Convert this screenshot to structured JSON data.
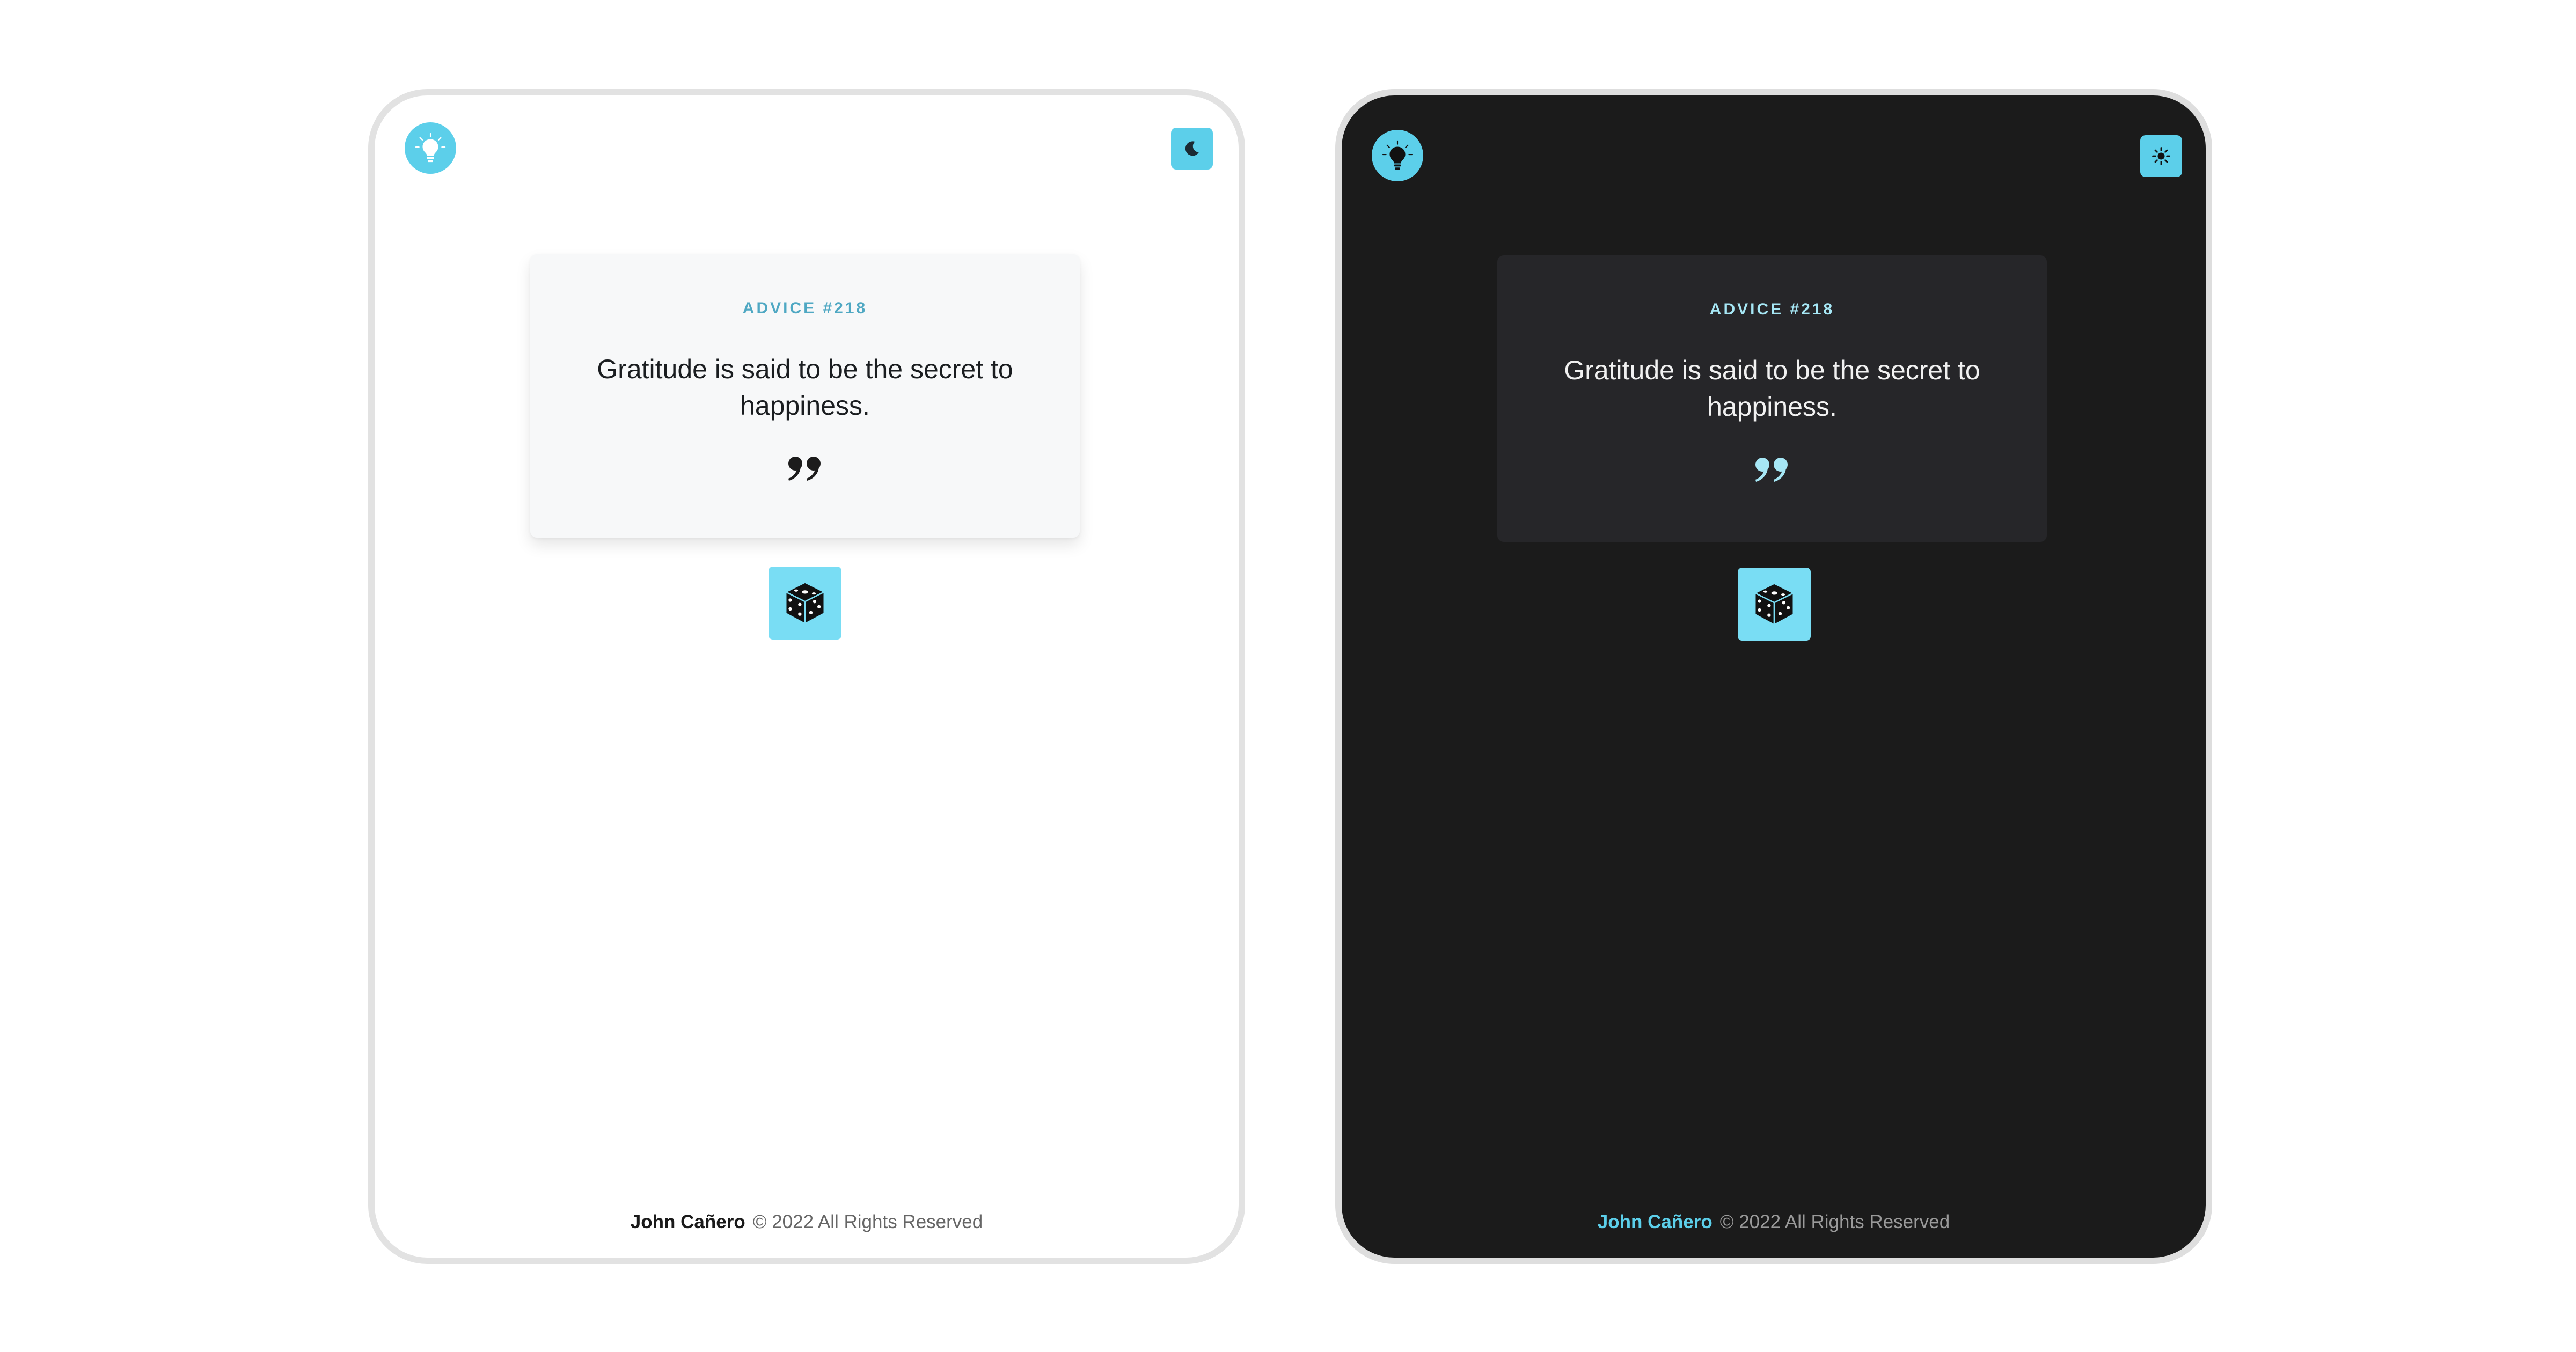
{
  "light_theme": {
    "advice_label": "ADVICE #218",
    "advice_text": "Gratitude is said to be the secret to happiness.",
    "footer": {
      "author": "John Cañero",
      "rights": "© 2022 All Rights Reserved"
    },
    "icons": {
      "logo": "lightbulb-icon",
      "theme_toggle": "moon-icon",
      "quote": "quote-icon",
      "generate": "dice-icon"
    }
  },
  "dark_theme": {
    "advice_label": "ADVICE #218",
    "advice_text": "Gratitude is said to be the secret to happiness.",
    "footer": {
      "author": "John Cañero",
      "rights": "© 2022 All Rights Reserved"
    },
    "icons": {
      "logo": "lightbulb-icon",
      "theme_toggle": "sun-icon",
      "quote": "quote-icon",
      "generate": "dice-icon"
    }
  },
  "colors": {
    "accent": "#5ccfea",
    "dice_button": "#79ddf4",
    "light_card": "#f7f8f9",
    "dark_background": "#1b1b1b",
    "dark_card": "#262629"
  }
}
